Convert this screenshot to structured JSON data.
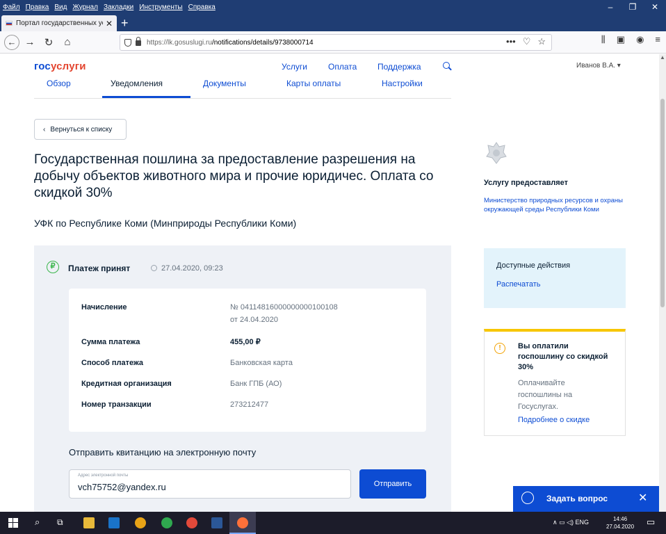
{
  "browser": {
    "menu": [
      "Файл",
      "Правка",
      "Вид",
      "Журнал",
      "Закладки",
      "Инструменты",
      "Справка"
    ],
    "window_controls": [
      "–",
      "❐",
      "✕"
    ],
    "tab_title": "Портал государственных усл",
    "url_host": "https://lk.gosuslugi.ru",
    "url_path": "/notifications/details/9738000714",
    "url_more": "•••"
  },
  "header": {
    "logo_part1": "гос",
    "logo_part2": "услуги",
    "nav": [
      "Услуги",
      "Оплата",
      "Поддержка"
    ],
    "user": "Иванов В.А. ▾"
  },
  "subnav": [
    "Обзор",
    "Уведомления",
    "Документы",
    "Карты оплаты",
    "Настройки"
  ],
  "back_label": "Вернуться к списку",
  "title": "Государственная пошлина за предоставление разрешения на добычу объектов животного мира и прочие юридичес. Оплата со скидкой 30%",
  "recipient": "УФК по Республике Коми (Минприроды Республики Коми)",
  "payment": {
    "status": "Платеж принят",
    "status_icon": "₽",
    "datetime": "27.04.2020, 09:23",
    "rows": [
      {
        "label": "Начисление",
        "value": "№ 04114816000000000100108",
        "value2": "от 24.04.2020"
      },
      {
        "label": "Сумма платежа",
        "value": "455,00 ₽"
      },
      {
        "label": "Способ платежа",
        "value": "Банковская карта"
      },
      {
        "label": "Кредитная организация",
        "value": "Банк ГПБ (АО)"
      },
      {
        "label": "Номер транзакции",
        "value": "273212477"
      }
    ]
  },
  "email": {
    "title": "Отправить квитанцию на электронную почту",
    "field_label": "Адрес электронной почты",
    "value": "vch75752@yandex.ru",
    "send": "Отправить"
  },
  "provider": {
    "title": "Услугу предоставляет",
    "name": "Министерство природных ресурсов и охраны окружающей среды Республики Коми"
  },
  "actions": {
    "title": "Доступные действия",
    "print": "Распечатать"
  },
  "promo": {
    "title": "Вы оплатили госпошлину со скидкой 30%",
    "desc": "Оплачивайте госпошлины на Госуслугах.",
    "link": "Подробнее о скидке"
  },
  "chat": {
    "label": "Задать вопрос",
    "close": "✕"
  },
  "taskbar": {
    "lang": "ENG",
    "time": "14:46",
    "date": "27.04.2020"
  },
  "colors": {
    "brand_blue": "#0d4cd3",
    "brand_red": "#e3452f",
    "success": "#39b54a",
    "warning": "#f7c600",
    "browser_frame": "#1f3d73"
  }
}
